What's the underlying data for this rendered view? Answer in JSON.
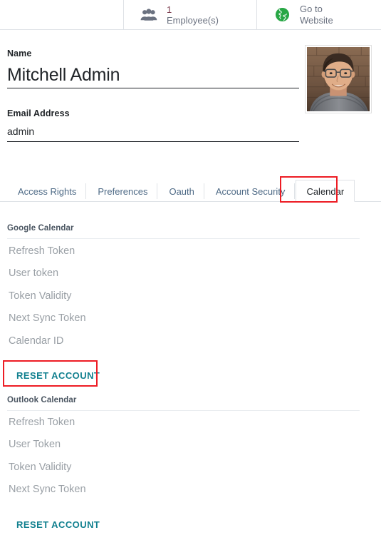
{
  "smart_buttons": [
    {
      "name": "employees",
      "icon": "people-icon",
      "value": "1",
      "label": "Employee(s)",
      "label_line2": ""
    },
    {
      "name": "website",
      "icon": "globe-icon",
      "value": "",
      "label": "Go to",
      "label_line2": "Website"
    }
  ],
  "form": {
    "name": {
      "label": "Name",
      "value": "Mitchell Admin",
      "placeholder": "e.g. Mitchell Admin"
    },
    "email": {
      "label": "Email Address",
      "value": "admin",
      "placeholder": "e.g. email@yourcompany.com"
    },
    "avatar_alt": "user-avatar-photo"
  },
  "tabs": [
    {
      "label": "Access Rights",
      "active": false
    },
    {
      "label": "Preferences",
      "active": false
    },
    {
      "label": "Oauth",
      "active": false
    },
    {
      "label": "Account Security",
      "active": false
    },
    {
      "label": "Calendar",
      "active": true
    }
  ],
  "google_calendar": {
    "title": "Google Calendar",
    "fields": [
      "Refresh Token",
      "User token",
      "Token Validity",
      "Next Sync Token",
      "Calendar ID"
    ],
    "reset_label": "RESET ACCOUNT"
  },
  "outlook_calendar": {
    "title": "Outlook Calendar",
    "fields": [
      "Refresh Token",
      "User Token",
      "Token Validity",
      "Next Sync Token"
    ],
    "reset_label": "RESET ACCOUNT"
  },
  "colors": {
    "accent_teal": "#11808f",
    "annotation_red": "#ed1c24",
    "smart_value": "#7d3d4e",
    "globe_green": "#28a745",
    "tab_inactive": "#4e6a86",
    "readonly_gray": "#9aa0a6"
  }
}
